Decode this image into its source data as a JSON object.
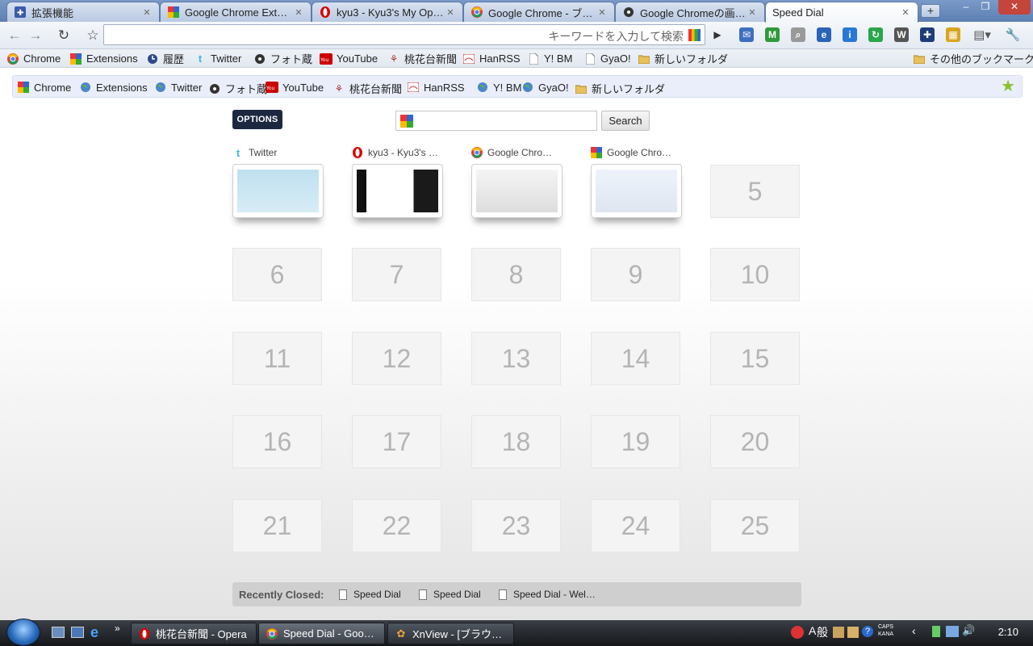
{
  "tabs": [
    {
      "title": "拡張機能",
      "icon": "puzzle-icon",
      "active": false
    },
    {
      "title": "Google Chrome Exte…",
      "icon": "google-icon",
      "active": false
    },
    {
      "title": "kyu3 - Kyu3's My Op…",
      "icon": "opera-icon",
      "active": false
    },
    {
      "title": "Google Chrome - ブ…",
      "icon": "chrome-icon",
      "active": false
    },
    {
      "title": "Google Chromeの画…",
      "icon": "photozou-icon",
      "active": false
    },
    {
      "title": "Speed Dial",
      "icon": "",
      "active": true
    }
  ],
  "toolbar": {
    "omnibox_placeholder": "キーワードを入力して検索",
    "extensions": [
      {
        "icon": "gmail-checker-icon",
        "glyph": "✉",
        "color": "#3d6fbf"
      },
      {
        "icon": "gmail-icon",
        "glyph": "M",
        "color": "#2e9a3a"
      },
      {
        "icon": "search-icon",
        "glyph": "⌕",
        "color": "#999999"
      },
      {
        "icon": "ie-tab-icon",
        "glyph": "e",
        "color": "#2a64b8"
      },
      {
        "icon": "info-icon",
        "glyph": "i",
        "color": "#2a78d6"
      },
      {
        "icon": "refresh-ext-icon",
        "glyph": "↻",
        "color": "#2aa54a"
      },
      {
        "icon": "wikipedia-icon",
        "glyph": "W",
        "color": "#555555"
      },
      {
        "icon": "puzzle-ext-icon",
        "glyph": "✚",
        "color": "#1f3c7a"
      },
      {
        "icon": "palette-icon",
        "glyph": "▦",
        "color": "#d9a520"
      }
    ]
  },
  "bookmarks": [
    {
      "label": "Chrome",
      "icon": "chrome-icon"
    },
    {
      "label": "Extensions",
      "icon": "google-icon"
    },
    {
      "label": "履歴",
      "icon": "clock-icon"
    },
    {
      "label": "Twitter",
      "icon": "twitter-icon"
    },
    {
      "label": "フォト蔵",
      "icon": "photozou-icon"
    },
    {
      "label": "YouTube",
      "icon": "youtube-icon"
    },
    {
      "label": "桃花台新聞",
      "icon": "news-icon"
    },
    {
      "label": "HanRSS",
      "icon": "hanrss-icon"
    },
    {
      "label": "Y! BM",
      "icon": "page-icon"
    },
    {
      "label": "GyaO!",
      "icon": "page-icon"
    },
    {
      "label": "新しいフォルダ",
      "icon": "folder-icon"
    }
  ],
  "other_bookmarks": "その他のブックマーク",
  "speeddial_bar": [
    {
      "label": "Chrome",
      "icon": "google-icon"
    },
    {
      "label": "Extensions",
      "icon": "globe-icon"
    },
    {
      "label": "Twitter",
      "icon": "globe-icon"
    },
    {
      "label": "フォト蔵",
      "icon": "photozou-icon"
    },
    {
      "label": "YouTube",
      "icon": "youtube-icon"
    },
    {
      "label": "桃花台新聞",
      "icon": "news-icon"
    },
    {
      "label": "HanRSS",
      "icon": "hanrss-icon"
    },
    {
      "label": "Y! BM",
      "icon": "globe-icon"
    },
    {
      "label": "GyaO!",
      "icon": "globe-icon"
    },
    {
      "label": "新しいフォルダ",
      "icon": "folder-icon"
    }
  ],
  "options_label": "OPTIONS",
  "search_button": "Search",
  "dials": [
    {
      "title": "Twitter",
      "icon": "twitter-icon"
    },
    {
      "title": "kyu3 - Kyu3's …",
      "icon": "opera-icon"
    },
    {
      "title": "Google Chro…",
      "icon": "chrome-icon"
    },
    {
      "title": "Google Chro…",
      "icon": "google-icon"
    }
  ],
  "empty_slots": [
    "5",
    "6",
    "7",
    "8",
    "9",
    "10",
    "11",
    "12",
    "13",
    "14",
    "15",
    "16",
    "17",
    "18",
    "19",
    "20",
    "21",
    "22",
    "23",
    "24",
    "25"
  ],
  "recently_closed": {
    "label": "Recently Closed:",
    "items": [
      "Speed Dial",
      "Speed Dial",
      "Speed Dial - Wel…"
    ]
  },
  "taskbar": {
    "tasks": [
      {
        "label": "桃花台新聞 - Opera",
        "icon": "opera-icon"
      },
      {
        "label": "Speed Dial - Goo…",
        "icon": "chrome-icon"
      },
      {
        "label": "XnView - [ブラウ…",
        "icon": "xnview-icon"
      }
    ],
    "ime": "般",
    "ime_a": "A",
    "caps": "CAPS",
    "kana": "KANA",
    "clock": "2:10"
  }
}
